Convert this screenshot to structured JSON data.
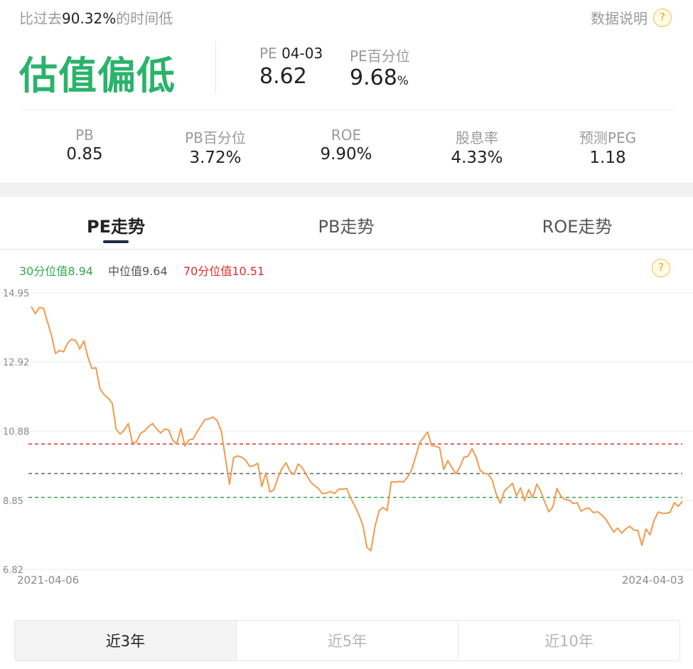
{
  "header": {
    "summary_prefix": "比过去",
    "summary_value": "90.32%",
    "summary_suffix": "的时间低",
    "help_label": "数据说明",
    "help_icon": "?"
  },
  "valuation": {
    "status": "估值偏低",
    "pe_label": "PE",
    "pe_date": "04-03",
    "pe_value": "8.62",
    "pe_pct_label": "PE百分位",
    "pe_pct_value": "9.68",
    "pe_pct_unit": "%"
  },
  "metrics": [
    {
      "label": "PB",
      "value": "0.85"
    },
    {
      "label": "PB百分位",
      "value": "3.72%"
    },
    {
      "label": "ROE",
      "value": "9.90%"
    },
    {
      "label": "股息率",
      "value": "4.33%"
    },
    {
      "label": "预测PEG",
      "value": "1.18"
    }
  ],
  "tabs": [
    {
      "label": "PE走势",
      "active": true
    },
    {
      "label": "PB走势",
      "active": false
    },
    {
      "label": "ROE走势",
      "active": false
    }
  ],
  "legend": {
    "p30": "30分位值8.94",
    "median": "中位值9.64",
    "p70": "70分位值10.51"
  },
  "ranges": [
    {
      "label": "近3年",
      "active": true
    },
    {
      "label": "近5年",
      "active": false
    },
    {
      "label": "近10年",
      "active": false
    }
  ],
  "colors": {
    "accent_green": "#2bb36b",
    "line": "#f39a4c",
    "p30": "#2fa84f",
    "median": "#666666",
    "p70": "#e02b2b"
  },
  "chart_data": {
    "type": "line",
    "x_start": "2021-04-06",
    "x_end": "2024-04-03",
    "ylim": [
      6.82,
      14.95
    ],
    "yticks": [
      "14.95",
      "12.92",
      "10.88",
      "8.85",
      "6.82"
    ],
    "reference_lines": [
      {
        "name": "30分位值",
        "value": 8.94
      },
      {
        "name": "中位值",
        "value": 9.64
      },
      {
        "name": "70分位值",
        "value": 10.51
      }
    ],
    "series": [
      {
        "values": [
          14.55,
          14.34,
          14.52,
          14.5,
          14.1,
          13.7,
          13.17,
          13.26,
          13.22,
          13.48,
          13.59,
          13.55,
          13.3,
          13.54,
          13.06,
          12.73,
          12.75,
          12.13,
          11.96,
          11.86,
          11.71,
          10.94,
          10.8,
          10.92,
          11.11,
          10.55,
          10.56,
          10.82,
          10.89,
          11.02,
          11.11,
          10.95,
          10.83,
          10.95,
          10.92,
          10.62,
          10.51,
          10.96,
          10.45,
          10.63,
          10.65,
          10.87,
          11.05,
          11.23,
          11.25,
          11.3,
          11.19,
          10.89,
          10.1,
          9.32,
          10.1,
          10.16,
          10.12,
          10.04,
          9.85,
          9.87,
          9.94,
          9.26,
          9.66,
          9.1,
          9.16,
          9.52,
          9.79,
          9.96,
          9.71,
          9.61,
          9.92,
          9.81,
          9.61,
          9.4,
          9.29,
          9.2,
          9.05,
          9.07,
          9.11,
          9.05,
          9.18,
          9.18,
          9.2,
          8.91,
          8.69,
          8.43,
          8.13,
          7.47,
          7.37,
          8.08,
          8.55,
          8.64,
          8.55,
          9.4,
          9.39,
          9.41,
          9.39,
          9.52,
          9.73,
          10.11,
          10.54,
          10.7,
          10.86,
          10.46,
          10.44,
          10.4,
          9.76,
          10.02,
          9.82,
          9.63,
          9.84,
          10.12,
          10.15,
          10.37,
          10.12,
          9.74,
          9.64,
          9.63,
          9.44,
          9.03,
          8.77,
          9.13,
          9.24,
          9.35,
          8.99,
          9.22,
          8.84,
          9.17,
          8.93,
          9.33,
          9.12,
          8.79,
          8.51,
          8.66,
          9.2,
          8.97,
          8.88,
          8.86,
          8.76,
          8.78,
          8.53,
          8.61,
          8.62,
          8.49,
          8.52,
          8.43,
          8.31,
          8.12,
          7.92,
          8.04,
          7.89,
          8.01,
          8.09,
          7.98,
          7.97,
          7.53,
          8.01,
          7.84,
          8.25,
          8.51,
          8.47,
          8.47,
          8.5,
          8.78,
          8.68,
          8.82
        ]
      }
    ]
  }
}
